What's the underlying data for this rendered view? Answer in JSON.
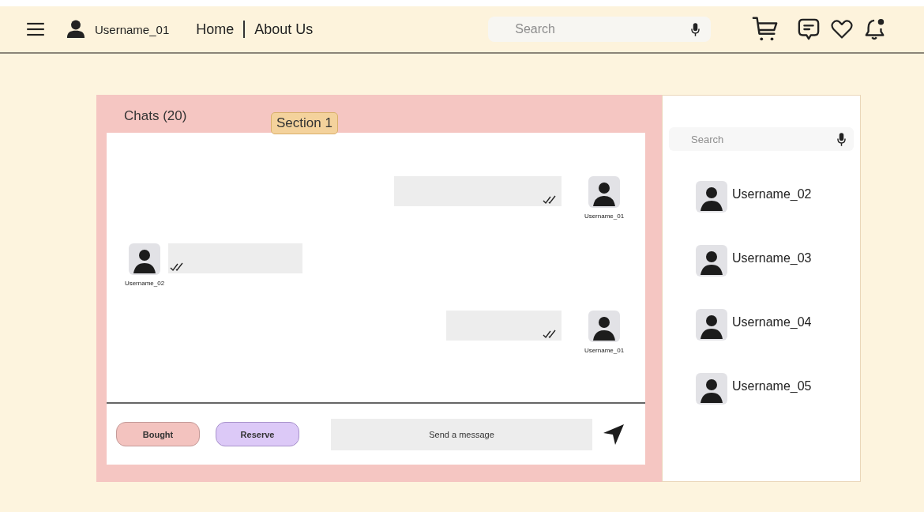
{
  "header": {
    "username": "Username_01",
    "nav": [
      {
        "label": "Home"
      },
      {
        "label": "About Us"
      }
    ],
    "search": {
      "placeholder": "Search"
    }
  },
  "chat": {
    "title": "Chats (20)",
    "badge": "Section 1",
    "messages": [
      {
        "kind": "sent",
        "author": "Username_01",
        "read": true
      },
      {
        "kind": "received",
        "author": "Username_02",
        "read": true
      },
      {
        "kind": "sent",
        "author": "Username_01",
        "read": true
      }
    ],
    "actions": [
      {
        "label": "Bought",
        "color": "#f3c3bf"
      },
      {
        "label": "Reserve",
        "color": "#dcc9f7"
      }
    ],
    "composer": {
      "placeholder": "Send a message"
    }
  },
  "contacts": {
    "search": {
      "placeholder": "Search"
    },
    "items": [
      {
        "name": "Username_02"
      },
      {
        "name": "Username_03"
      },
      {
        "name": "Username_04"
      },
      {
        "name": "Username_05"
      }
    ]
  }
}
